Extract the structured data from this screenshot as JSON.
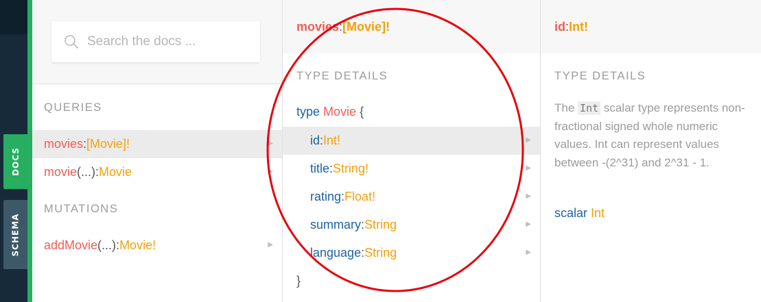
{
  "sidebar_tabs": {
    "docs": "DOCS",
    "schema": "SCHEMA"
  },
  "search": {
    "placeholder": "Search the docs ..."
  },
  "explorer": {
    "queries_title": "QUERIES",
    "queries": [
      {
        "name": "movies",
        "args": "",
        "colon": ": ",
        "type": "[Movie]!"
      },
      {
        "name": "movie",
        "args": "(...)",
        "colon": ": ",
        "type": "Movie"
      }
    ],
    "mutations_title": "MUTATIONS",
    "mutations": [
      {
        "name": "addMovie",
        "args": "(...)",
        "colon": ": ",
        "type": "Movie!"
      }
    ]
  },
  "movies_panel": {
    "header": {
      "name": "movies",
      "colon": ": ",
      "type": "[Movie]!"
    },
    "section_title": "TYPE DETAILS",
    "type_keyword": "type",
    "type_name": "Movie",
    "open_brace": "{",
    "close_brace": "}",
    "fields": [
      {
        "name": "id",
        "colon": ": ",
        "type": "Int!"
      },
      {
        "name": "title",
        "colon": ": ",
        "type": "String!"
      },
      {
        "name": "rating",
        "colon": ": ",
        "type": "Float!"
      },
      {
        "name": "summary",
        "colon": ": ",
        "type": "String"
      },
      {
        "name": "language",
        "colon": ": ",
        "type": "String"
      }
    ]
  },
  "id_panel": {
    "header": {
      "name": "id",
      "colon": ": ",
      "type": "Int!"
    },
    "section_title": "TYPE DETAILS",
    "description": {
      "line1_before": "The ",
      "line1_code": "Int",
      "line1_after": " scalar type represents non-",
      "line2": "fractional signed whole numeric",
      "line3": "values. Int can represent values",
      "line4": "between -(2^31) and 2^31 - 1."
    },
    "scalar_keyword": "scalar",
    "scalar_type": "Int"
  },
  "colors": {
    "accent_green": "#27ae60",
    "field_name": "#f25c54",
    "type_color": "#f5a00a",
    "keyword_blue": "#1f61a0",
    "annotation_red": "#e8000b"
  },
  "annotation": "red-ellipse-around-type-details"
}
